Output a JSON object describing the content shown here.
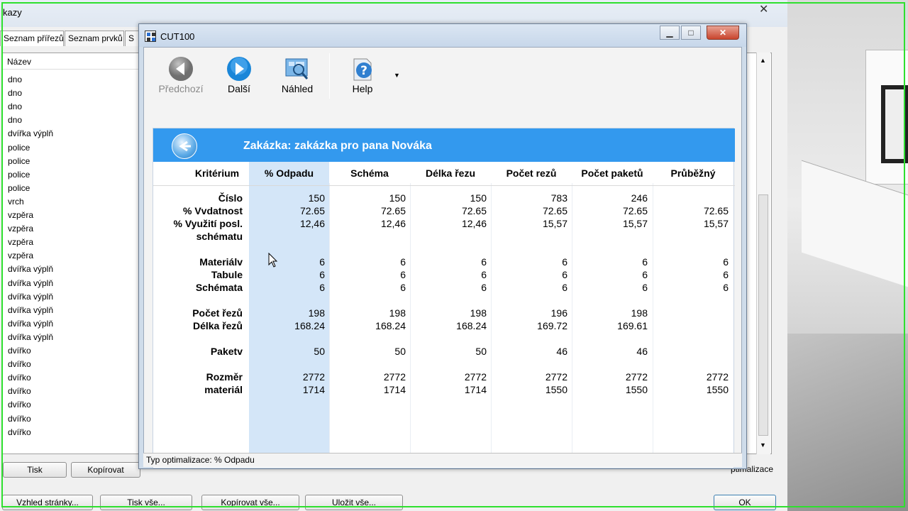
{
  "background_window": {
    "title": "kazy",
    "tabs": [
      "Seznam přířezů",
      "Seznam prvků",
      "S"
    ],
    "list_header": "Název",
    "list_items": [
      "dno",
      "dno",
      "dno",
      "dno",
      "dvířka výplň",
      "police",
      "police",
      "police",
      "police",
      "vrch",
      "vzpěra",
      "vzpěra",
      "vzpěra",
      "vzpěra",
      "dvířka výplň",
      "dvířka výplň",
      "dvířka výplň",
      "dvířka výplň",
      "dvířka výplň",
      "dvířka výplň",
      "dvířko",
      "dvířko",
      "dvířko",
      "dvířko",
      "dvířko",
      "dvířko",
      "dvířko"
    ],
    "buttons_row1": {
      "print": "Tisk",
      "copy": "Kopírovat"
    },
    "buttons_row2": {
      "page_look": "Vzhled stránky...",
      "print_all": "Tisk vše...",
      "copy_all": "Kopírovat vše...",
      "save_all": "Uložit vše...",
      "ok": "OK"
    },
    "partial_text": "ptimalizace"
  },
  "dialog": {
    "title": "CUT100",
    "toolbar": {
      "prev": "Předchozí",
      "next": "Další",
      "preview": "Náhled",
      "help": "Help"
    },
    "banner_title": "Zakázka: zakázka pro pana Nováka",
    "status": "Typ optimalizace: % Odpadu",
    "table": {
      "headers": [
        "Kritérium",
        "% Odpadu",
        "Schéma",
        "Délka řezu",
        "Počet rezů",
        "Počet paketů",
        "Průběžný"
      ],
      "rows": [
        {
          "label": "Číslo",
          "values": [
            "150",
            "150",
            "150",
            "783",
            "246",
            ""
          ]
        },
        {
          "label": "% Vvdatnost",
          "values": [
            "72.65",
            "72.65",
            "72.65",
            "72.65",
            "72.65",
            "72.65"
          ]
        },
        {
          "label": "% Využití posl.",
          "values": [
            "12,46",
            "12,46",
            "12,46",
            "15,57",
            "15,57",
            "15,57"
          ]
        },
        {
          "label": "schématu",
          "values": [
            "",
            "",
            "",
            "",
            "",
            ""
          ]
        },
        {
          "label": "Materiálv",
          "values": [
            "6",
            "6",
            "6",
            "6",
            "6",
            "6"
          ]
        },
        {
          "label": "Tabule",
          "values": [
            "6",
            "6",
            "6",
            "6",
            "6",
            "6"
          ]
        },
        {
          "label": "Schémata",
          "values": [
            "6",
            "6",
            "6",
            "6",
            "6",
            "6"
          ]
        },
        {
          "label": "Počet řezů",
          "values": [
            "198",
            "198",
            "198",
            "196",
            "198",
            ""
          ]
        },
        {
          "label": "Délka řezů",
          "values": [
            "168.24",
            "168.24",
            "168.24",
            "169.72",
            "169.61",
            ""
          ]
        },
        {
          "label": "Paketv",
          "values": [
            "50",
            "50",
            "50",
            "46",
            "46",
            ""
          ]
        },
        {
          "label": "Rozměr",
          "values": [
            "2772",
            "2772",
            "2772",
            "2772",
            "2772",
            "2772"
          ]
        },
        {
          "label": "materiál",
          "values": [
            "1714",
            "1714",
            "1714",
            "1550",
            "1550",
            "1550"
          ]
        }
      ]
    }
  },
  "colors": {
    "banner": "#3399ee",
    "selected_column": "#d4e6f8",
    "frame": "#2ee02e"
  }
}
